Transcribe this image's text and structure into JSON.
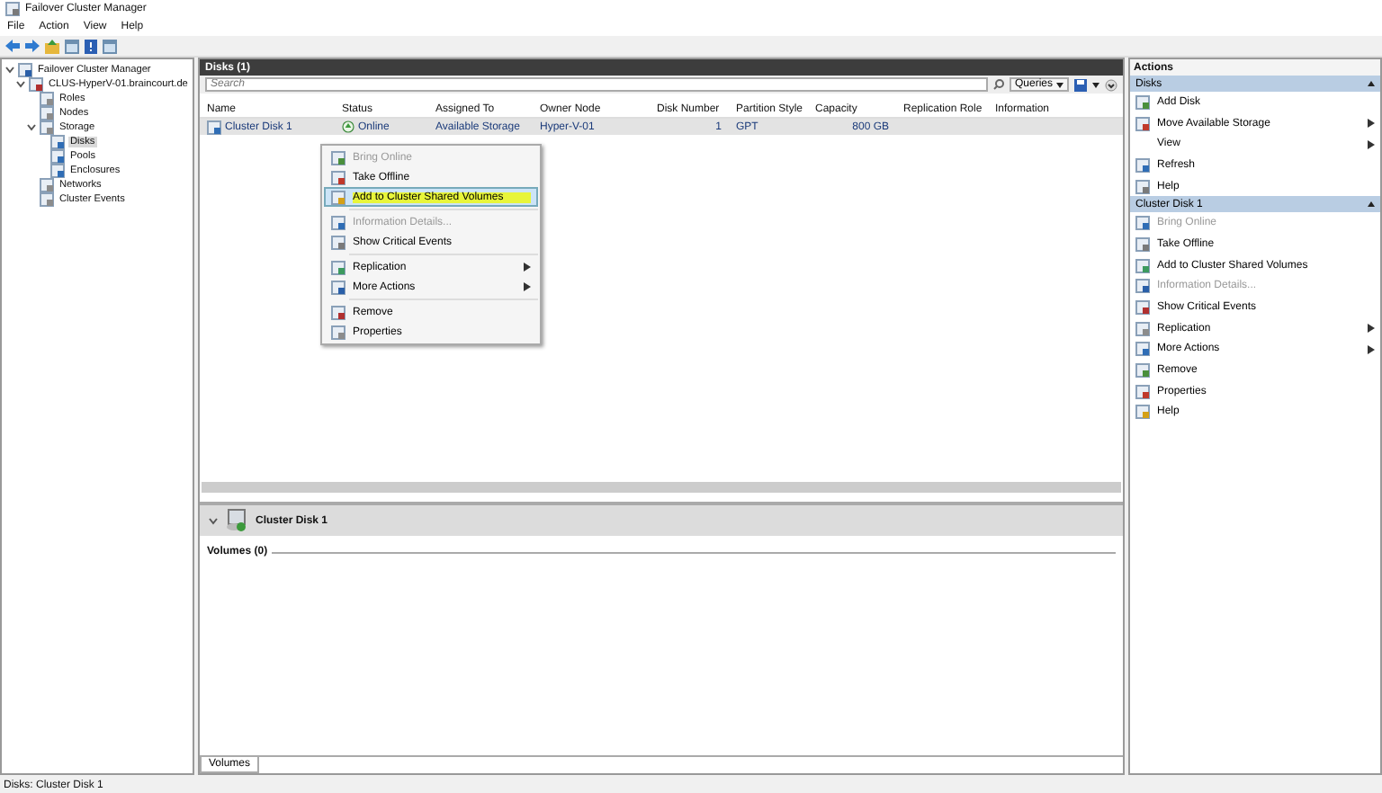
{
  "window": {
    "title": "Failover Cluster Manager"
  },
  "menu": [
    "File",
    "Action",
    "View",
    "Help"
  ],
  "tree": [
    {
      "label": "Failover Cluster Manager",
      "expanded": true,
      "selected": false,
      "children": [
        {
          "label": "CLUS-HyperV-01.braincourt.de",
          "expanded": true,
          "selected": false,
          "children": [
            {
              "label": "Roles",
              "selected": false
            },
            {
              "label": "Nodes",
              "selected": false
            },
            {
              "label": "Storage",
              "expanded": true,
              "selected": false,
              "children": [
                {
                  "label": "Disks",
                  "selected": true
                },
                {
                  "label": "Pools",
                  "selected": false
                },
                {
                  "label": "Enclosures",
                  "selected": false
                }
              ]
            },
            {
              "label": "Networks",
              "selected": false
            },
            {
              "label": "Cluster Events",
              "selected": false
            }
          ]
        }
      ]
    }
  ],
  "center": {
    "title": "Disks (1)",
    "search": {
      "placeholder": "Search"
    },
    "queries": "Queries",
    "columns": [
      "Name",
      "Status",
      "Assigned To",
      "Owner Node",
      "Disk Number",
      "Partition Style",
      "Capacity",
      "Replication Role",
      "Information"
    ],
    "rows": [
      {
        "cells": [
          "Cluster Disk 1",
          "Online",
          "Available Storage",
          "Hyper-V-01",
          "1",
          "GPT",
          "800 GB"
        ],
        "selected": true
      }
    ]
  },
  "context_menu": [
    {
      "label": "Bring Online",
      "disabled": true,
      "selected": false,
      "submenu": false
    },
    {
      "label": "Take Offline",
      "disabled": false,
      "selected": false,
      "submenu": false
    },
    {
      "label": "Add to Cluster Shared Volumes",
      "disabled": false,
      "selected": true,
      "submenu": false
    },
    {
      "label": "Information Details...",
      "disabled": true,
      "selected": false,
      "submenu": false
    },
    {
      "label": "Show Critical Events",
      "disabled": false,
      "selected": false,
      "submenu": false
    },
    {
      "label": "Replication",
      "disabled": false,
      "selected": false,
      "submenu": true
    },
    {
      "label": "More Actions",
      "disabled": false,
      "selected": false,
      "submenu": true
    },
    {
      "label": "Remove",
      "disabled": false,
      "selected": false,
      "submenu": false
    },
    {
      "label": "Properties",
      "disabled": false,
      "selected": false,
      "submenu": false
    }
  ],
  "details": {
    "title": "Cluster Disk 1",
    "expanded": true,
    "group": "Volumes (0)",
    "tabs": [
      {
        "label": "Volumes",
        "selected": true
      }
    ]
  },
  "actions": {
    "title": "Actions",
    "sections": [
      {
        "title": "Disks",
        "expanded": true,
        "items": [
          {
            "label": "Add Disk",
            "disabled": false,
            "submenu": false
          },
          {
            "label": "Move Available Storage",
            "disabled": false,
            "submenu": true
          },
          {
            "label": "View",
            "disabled": false,
            "submenu": true
          },
          {
            "label": "Refresh",
            "disabled": false,
            "submenu": false
          },
          {
            "label": "Help",
            "disabled": false,
            "submenu": false
          }
        ]
      },
      {
        "title": "Cluster Disk 1",
        "expanded": true,
        "items": [
          {
            "label": "Bring Online",
            "disabled": true,
            "submenu": false
          },
          {
            "label": "Take Offline",
            "disabled": false,
            "submenu": false
          },
          {
            "label": "Add to Cluster Shared Volumes",
            "disabled": false,
            "submenu": false
          },
          {
            "label": "Information Details...",
            "disabled": true,
            "submenu": false
          },
          {
            "label": "Show Critical Events",
            "disabled": false,
            "submenu": false
          },
          {
            "label": "Replication",
            "disabled": false,
            "submenu": true
          },
          {
            "label": "More Actions",
            "disabled": false,
            "submenu": true
          },
          {
            "label": "Remove",
            "disabled": false,
            "submenu": false
          },
          {
            "label": "Properties",
            "disabled": false,
            "submenu": false
          },
          {
            "label": "Help",
            "disabled": false,
            "submenu": false
          }
        ]
      }
    ]
  },
  "status_bar": "Disks:  Cluster Disk 1"
}
